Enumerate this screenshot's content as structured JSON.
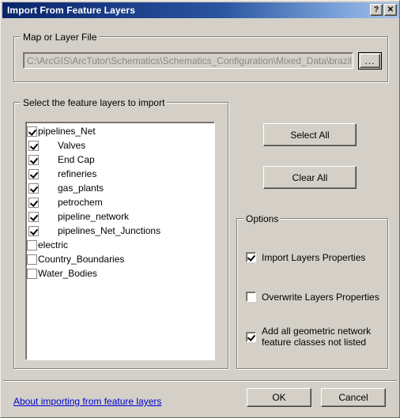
{
  "window": {
    "title": "Import From Feature Layers",
    "help_button": "?",
    "close_button": "✕"
  },
  "map_file_group": {
    "label": "Map or Layer File",
    "path_value": "C:\\ArcGIS\\ArcTutor\\Schematics\\Schematics_Configuration\\Mixed_Data\\brazil.mxd",
    "path_placeholder": "",
    "browse_label": "..."
  },
  "layers_group": {
    "label": "Select the feature layers to import",
    "items": [
      {
        "label": "pipelines_Net",
        "checked": true,
        "indent": 0
      },
      {
        "label": "Valves",
        "checked": true,
        "indent": 1
      },
      {
        "label": "End Cap",
        "checked": true,
        "indent": 1
      },
      {
        "label": "refineries",
        "checked": true,
        "indent": 1
      },
      {
        "label": "gas_plants",
        "checked": true,
        "indent": 1
      },
      {
        "label": "petrochem",
        "checked": true,
        "indent": 1
      },
      {
        "label": "pipeline_network",
        "checked": true,
        "indent": 1
      },
      {
        "label": "pipelines_Net_Junctions",
        "checked": true,
        "indent": 1
      },
      {
        "label": "electric",
        "checked": false,
        "indent": 0
      },
      {
        "label": "Country_Boundaries",
        "checked": false,
        "indent": 0
      },
      {
        "label": "Water_Bodies",
        "checked": false,
        "indent": 0
      }
    ]
  },
  "selection_buttons": {
    "select_all": "Select All",
    "clear_all": "Clear All"
  },
  "options_group": {
    "label": "Options",
    "items": [
      {
        "label": "Import Layers Properties",
        "checked": true
      },
      {
        "label": "Overwrite Layers Properties",
        "checked": false
      },
      {
        "label": "Add all geometric network\nfeature classes not listed",
        "checked": true
      }
    ]
  },
  "footer": {
    "about_link": "About importing from feature layers",
    "ok": "OK",
    "cancel": "Cancel"
  },
  "colors": {
    "dialog_face": "#d4d0c8",
    "title_gradient_start": "#0a246a",
    "title_gradient_end": "#a6c0e8",
    "link": "#0000cc",
    "disabled_text": "#8b8884"
  }
}
